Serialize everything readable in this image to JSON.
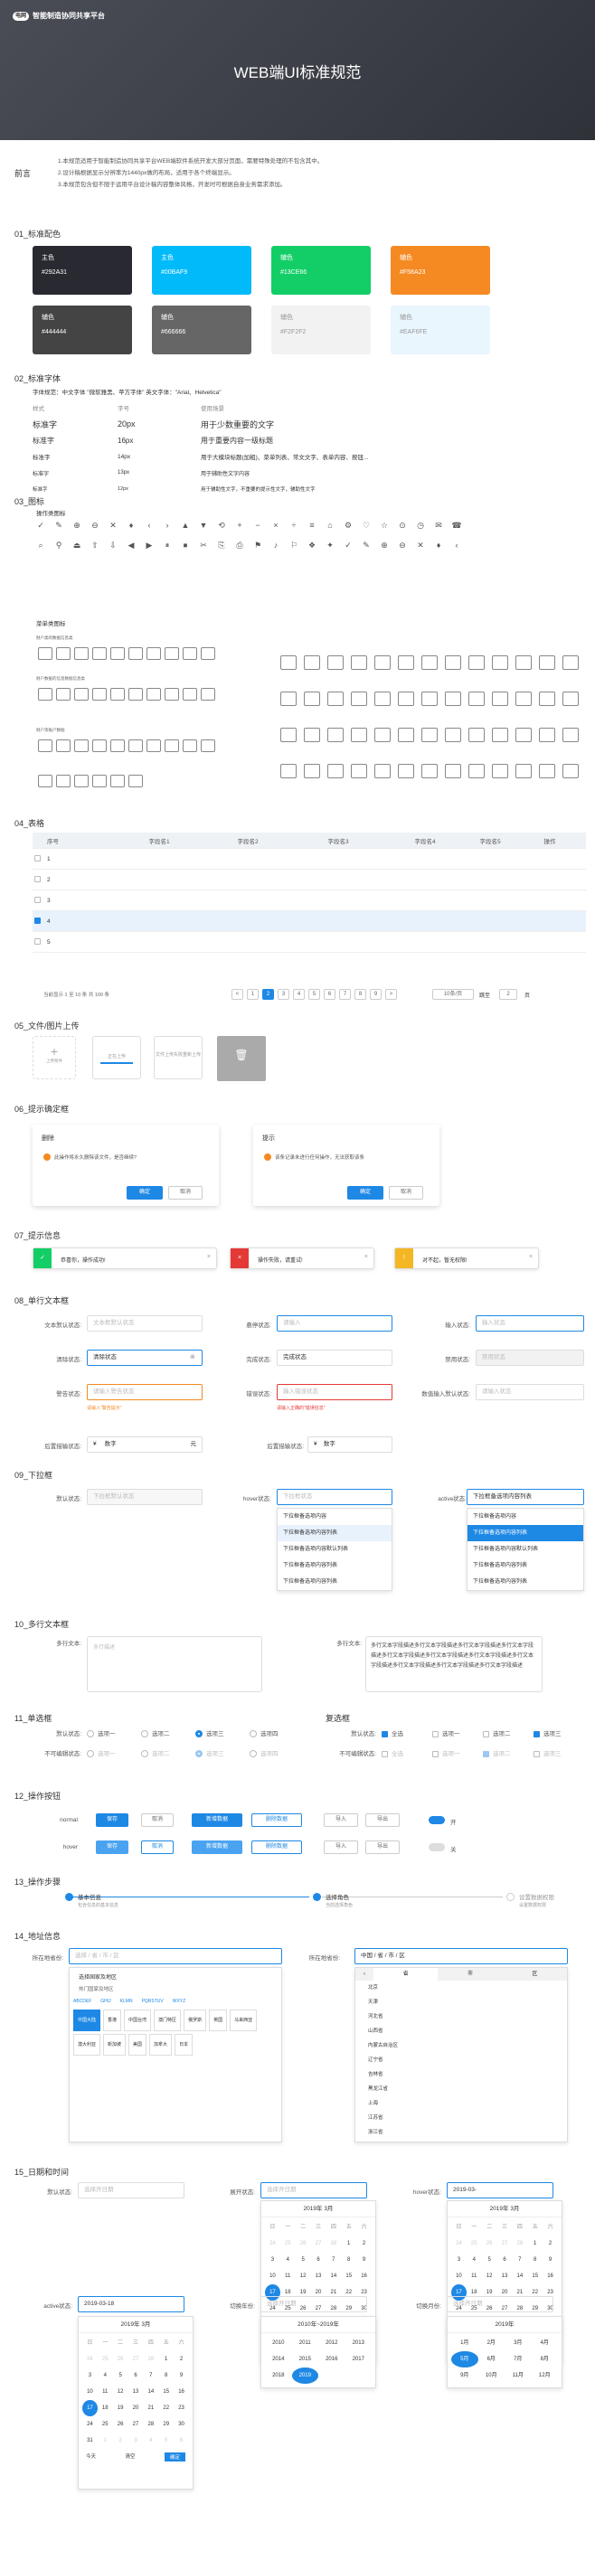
{
  "header": {
    "logo": "电网",
    "brand": "智能制造协同共享平台",
    "title": "WEB端UI标准规范"
  },
  "intro": {
    "label": "前言",
    "lines": [
      "1.本规范适用于智能制造协同共享平台WEB端软件系统开发大部分页面，需要特殊处理的不包含其中。",
      "2.设计稿根据显示分辨率为1440px做的布局，适用于各个终端显示。",
      "3.本规范包含但不限于运用平台设计稿内容整体风格，开发时可根据自身业务需求添加。"
    ]
  },
  "colors": {
    "title": "01_标准配色",
    "items": [
      {
        "name": "主色",
        "hex": "#292A31"
      },
      {
        "name": "主色",
        "hex": "#00BAF9"
      },
      {
        "name": "辅色",
        "hex": "#13CE66"
      },
      {
        "name": "辅色",
        "hex": "#F58A23"
      },
      {
        "name": "辅色",
        "hex": "#444444"
      },
      {
        "name": "辅色",
        "hex": "#666666"
      },
      {
        "name": "辅色",
        "hex": "#F2F2F2"
      },
      {
        "name": "辅色",
        "hex": "#EAF6FE"
      }
    ]
  },
  "fonts": {
    "title": "02_标准字体",
    "head": "字体规范：中文字体  \"微软雅黑、苹方字体\"      英文字体：\"Arial、Helvetica\"",
    "cols": [
      "样式",
      "字号",
      "使用场景"
    ],
    "rows": [
      [
        "标准字",
        "20px",
        "用于少数重要的文字"
      ],
      [
        "标准字",
        "16px",
        "用于重要内容一级标题"
      ],
      [
        "标准字",
        "14px",
        "用于大模块标题(加粗)、菜单列表、常文文字、表单内容、按钮..."
      ],
      [
        "标准字",
        "13px",
        "用于辅助性文字内容"
      ],
      [
        "标准字",
        "12px",
        "用于辅助性文字，不重要的提示性文字，辅助性文字"
      ]
    ]
  },
  "icons": {
    "title": "03_图标",
    "op": "操作类图标",
    "menu": "菜单类图标",
    "g1": "财户类的数据信息类",
    "g2": "财户数据的信息数据信息类",
    "g3": "财户等账户数据"
  },
  "table": {
    "title": "04_表格",
    "head": [
      "序号",
      "字段名1",
      "字段名2",
      "字段名3",
      "字段名4",
      "字段名5",
      "操作"
    ],
    "rows": [
      "1",
      "2",
      "3",
      "4",
      "5"
    ],
    "summary": "当前显示 1 至 10 条 共 100 条",
    "pages": [
      "<",
      "1",
      "2",
      "3",
      "4",
      "5",
      "6",
      "7",
      "8",
      "9",
      ">"
    ],
    "size": "10条/页",
    "jump": "跳至",
    "page": "2",
    "unit": "页"
  },
  "upload": {
    "title": "05_文件/图片上传",
    "a": "上传附件",
    "b": "正在上传",
    "c": "文件上传失败重新上传"
  },
  "confirm": {
    "title": "06_提示确定框",
    "t1": "删除",
    "m1": "此操作将永久删除该文件，是否继续?",
    "t2": "提示",
    "m2": "该条记录未进行任何操作，无法获取该条",
    "ok": "确定",
    "cancel": "取消"
  },
  "alerts": {
    "title": "07_提示信息",
    "s": "恭喜你，操作成功!",
    "e": "操作失败，请重试!",
    "w": "对不起，暂无权限!"
  },
  "inputs": {
    "title": "08_单行文本框",
    "l1": "文本默认状态:",
    "p1": "文本框默认状态",
    "l2": "悬停状态:",
    "p2": "请输入",
    "l3": "输入状态:",
    "p3": "输入状态",
    "l4": "清除状态:",
    "v4": "清除状态",
    "l5": "完成状态:",
    "v5": "完成状态",
    "l6": "禁用状态:",
    "v6": "禁用状态",
    "l7": "警告状态:",
    "p7": "请输入警告状态",
    "l8": "错误状态:",
    "p8": "输入错误状态",
    "l9": "数值输入默认状态:",
    "p9": "请输入状态",
    "w7": "请输入\"警告提示\"",
    "w8": "请输入正确的\"错误信息\"",
    "l10": "后置描输状态:",
    "v10": "数字",
    "u10": "元",
    "l11": "后置描输状态:",
    "v11": "数字"
  },
  "selects": {
    "title": "09_下拉框",
    "l1": "默认状态:",
    "p1": "下拉框默认状态",
    "l2": "hover状态:",
    "p2": "下拉框状态",
    "l3": "active状态:",
    "v3": "下拉框备选项内容列表",
    "opts": [
      "下拉框备选项内容",
      "下拉框备选项内容列表",
      "下拉框备选项内容默认列表",
      "下拉框备选项内容列表",
      "下拉框备选项内容列表"
    ]
  },
  "textarea": {
    "title": "10_多行文本框",
    "l1": "多行文本:",
    "p1": "多行描述",
    "l2": "多行文本:",
    "v2": "多行文本字段描述多行文本字段描述多行文本字段描述多行文本字段描述多行文本字段描述多行文本字段描述多行文本字段描述多行文本字段描述多行文本字段描述多行文本字段描述多行文本字段描述"
  },
  "choice": {
    "title": "11_单选框",
    "title2": "复选框",
    "r1": "默认状态:",
    "r2": "不可编辑状态:",
    "ro": [
      "选项一",
      "选项二",
      "选项三",
      "选项四"
    ],
    "c1": "默认状态:",
    "c2": "不可编辑状态:",
    "co": [
      "全选",
      "选项一",
      "选项二",
      "选项三"
    ]
  },
  "buttons": {
    "title": "12_操作按钮",
    "normal": "normal",
    "hover": "hover",
    "save": "保存",
    "cancel": "取消",
    "add": "新增数据",
    "del": "删除数据",
    "imp": "导入",
    "exp": "导出",
    "on": "开",
    "off": "关"
  },
  "steps": {
    "title": "13_操作步骤",
    "s1": "基本信息",
    "d1": "包含信息的基本信息",
    "s2": "选择角色",
    "d2": "当前选择角色",
    "s3": "设置数据权限",
    "d3": "设置数据权限"
  },
  "address": {
    "title": "14_地址信息",
    "l1": "所在地省份:",
    "p1": "选择 / 省 / 市 / 区",
    "l2": "所在地省份:",
    "p2": "中国 / 省 / 市 / 区",
    "tip": "选择国家及地区",
    "hot": "热门国家及地区",
    "abc": [
      "ABCDEF",
      "GHIJ",
      "KLMN",
      "PQRSTUV",
      "WXYZ"
    ],
    "tags": [
      "中国大陆",
      "香港",
      "中国台湾",
      "澳门特区",
      "俄罗斯",
      "英国",
      "马来西亚",
      "澳大利亚",
      "新加坡",
      "美国",
      "加拿大",
      "日本"
    ],
    "tabs": [
      "省",
      "市",
      "区"
    ],
    "prov": [
      "北京",
      "天津",
      "河北省",
      "山西省",
      "内蒙古自治区",
      "辽宁省",
      "吉林省",
      "黑龙江省",
      "上海",
      "江苏省",
      "浙江省"
    ]
  },
  "dates": {
    "title": "15_日期和时间",
    "l1": "默认状态:",
    "p1": "选择开日期",
    "l2": "展开状态:",
    "p2": "选择开日期",
    "l3": "hover状态:",
    "v3": "2019-03-",
    "l4": "active状态:",
    "v4": "2019-03-18",
    "l5": "切换年份:",
    "l6": "切换月份:",
    "month": "2019年 3月",
    "dec": "2010年~2019年",
    "yr": "2019年",
    "today": "今天",
    "clear": "清空",
    "ok": "确定",
    "wk": [
      "日",
      "一",
      "二",
      "三",
      "四",
      "五",
      "六"
    ],
    "years": [
      "2010",
      "2011",
      "2012",
      "2013",
      "2014",
      "2015",
      "2016",
      "2017",
      "2018",
      "2019"
    ],
    "months": [
      "1月",
      "2月",
      "3月",
      "4月",
      "5月",
      "6月",
      "7月",
      "8月",
      "9月",
      "10月",
      "11月",
      "12月"
    ]
  }
}
